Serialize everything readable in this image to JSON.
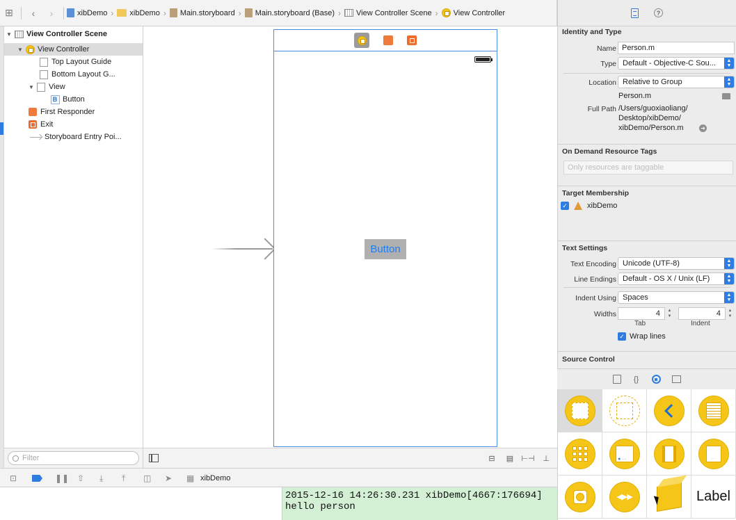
{
  "jumpbar": {
    "crumbs": [
      {
        "label": "xibDemo",
        "icon": "project-icon"
      },
      {
        "label": "xibDemo",
        "icon": "folder-icon"
      },
      {
        "label": "Main.storyboard",
        "icon": "storyboard-icon"
      },
      {
        "label": "Main.storyboard (Base)",
        "icon": "storyboard-icon"
      },
      {
        "label": "View Controller Scene",
        "icon": "scene-icon"
      },
      {
        "label": "View Controller",
        "icon": "view-controller-icon"
      }
    ]
  },
  "outline": {
    "items": [
      {
        "label": "View Controller Scene"
      },
      {
        "label": "View Controller"
      },
      {
        "label": "Top Layout Guide"
      },
      {
        "label": "Bottom Layout G..."
      },
      {
        "label": "View"
      },
      {
        "label": "Button"
      },
      {
        "label": "First Responder"
      },
      {
        "label": "Exit"
      },
      {
        "label": "Storyboard Entry Poi..."
      }
    ],
    "filter_placeholder": "Filter"
  },
  "canvas": {
    "button_label": "Button"
  },
  "debug": {
    "target": "xibDemo"
  },
  "console": {
    "lines": [
      "2015-12-16 14:26:30.231 xibDemo[4667:176694]",
      "hello person"
    ]
  },
  "inspector": {
    "identity": {
      "title": "Identity and Type",
      "name_label": "Name",
      "name_value": "Person.m",
      "type_label": "Type",
      "type_value": "Default - Objective-C Sou...",
      "location_label": "Location",
      "location_value": "Relative to Group",
      "filename": "Person.m",
      "fullpath_label": "Full Path",
      "fullpath_lines": [
        "/Users/guoxiaoliang/",
        "Desktop/xibDemo/",
        "xibDemo/Person.m"
      ]
    },
    "tags": {
      "title": "On Demand Resource Tags",
      "placeholder": "Only resources are taggable"
    },
    "target": {
      "title": "Target Membership",
      "item": "xibDemo"
    },
    "text_settings": {
      "title": "Text Settings",
      "encoding_label": "Text Encoding",
      "encoding_value": "Unicode (UTF-8)",
      "endings_label": "Line Endings",
      "endings_value": "Default - OS X / Unix (LF)",
      "indent_label": "Indent Using",
      "indent_value": "Spaces",
      "widths_label": "Widths",
      "tab_value": "4",
      "indent_width_value": "4",
      "tab_caption": "Tab",
      "indent_caption": "Indent",
      "wrap_label": "Wrap lines"
    },
    "source_control": {
      "title": "Source Control"
    }
  },
  "library": {
    "label_item": "Label"
  },
  "colors": {
    "accent": "#2f7de0",
    "console_bg": "#d3efd4",
    "object_yellow": "#f5c518"
  }
}
